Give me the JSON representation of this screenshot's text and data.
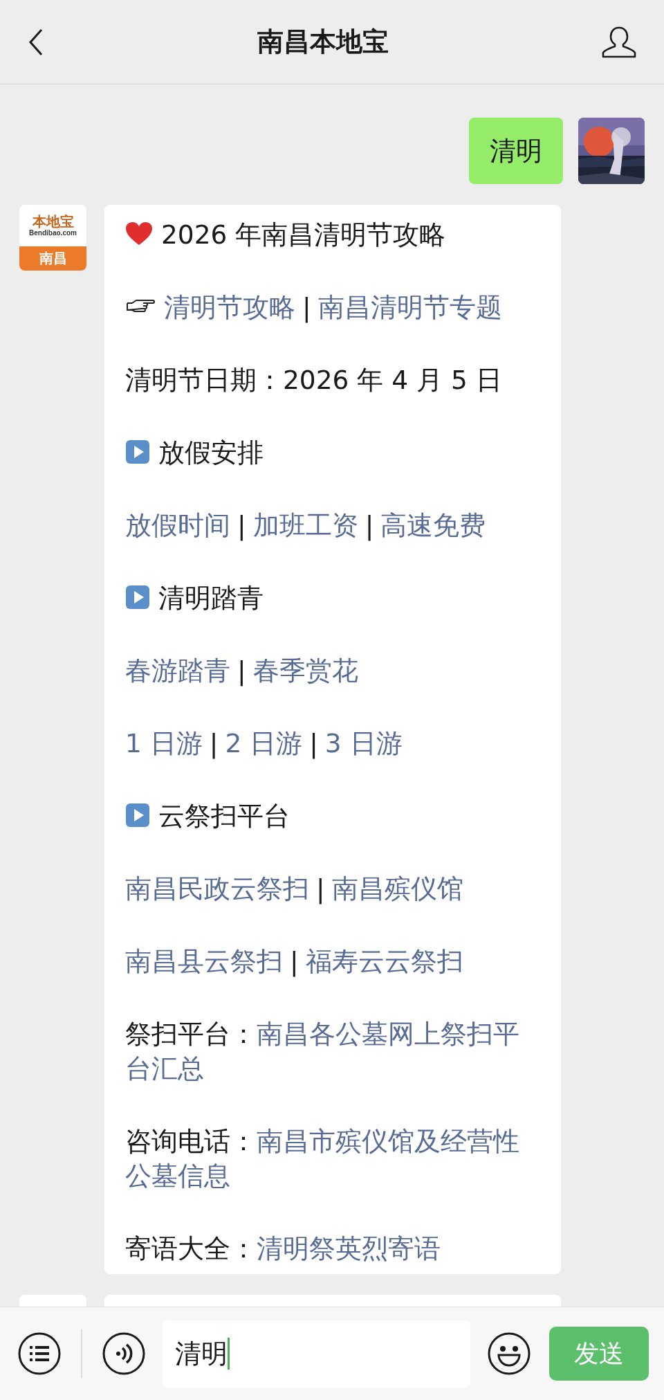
{
  "header": {
    "title": "南昌本地宝"
  },
  "user_message": {
    "text": "清明"
  },
  "bot_avatar": {
    "brand": "本地宝",
    "domain": "Bendibao.com",
    "city": "南昌"
  },
  "message": [
    {
      "kind": "title",
      "parts": [
        {
          "kind": "plain",
          "text": "2026 年南昌清明节攻略"
        }
      ]
    },
    {
      "kind": "pointer",
      "parts": [
        {
          "kind": "link",
          "text": "清明节攻略"
        },
        {
          "kind": "sep",
          "text": "|"
        },
        {
          "kind": "link",
          "text": "南昌清明节专题"
        }
      ]
    },
    {
      "kind": "line",
      "parts": [
        {
          "kind": "plain",
          "text": "清明节日期：2026 年 4 月 5 日"
        }
      ]
    },
    {
      "kind": "heading",
      "parts": [
        {
          "kind": "plain",
          "text": "放假安排"
        }
      ]
    },
    {
      "kind": "line",
      "parts": [
        {
          "kind": "link",
          "text": "放假时间"
        },
        {
          "kind": "sep",
          "text": "|"
        },
        {
          "kind": "link",
          "text": "加班工资"
        },
        {
          "kind": "sep",
          "text": "|"
        },
        {
          "kind": "link",
          "text": "高速免费"
        }
      ]
    },
    {
      "kind": "heading",
      "parts": [
        {
          "kind": "plain",
          "text": "清明踏青"
        }
      ]
    },
    {
      "kind": "line",
      "parts": [
        {
          "kind": "link",
          "text": "春游踏青"
        },
        {
          "kind": "sep",
          "text": "|"
        },
        {
          "kind": "link",
          "text": "春季赏花"
        }
      ]
    },
    {
      "kind": "line",
      "parts": [
        {
          "kind": "link",
          "text": "1 日游"
        },
        {
          "kind": "sep",
          "text": "|"
        },
        {
          "kind": "link",
          "text": "2 日游"
        },
        {
          "kind": "sep",
          "text": "|"
        },
        {
          "kind": "link",
          "text": "3 日游"
        }
      ]
    },
    {
      "kind": "heading",
      "parts": [
        {
          "kind": "plain",
          "text": "云祭扫平台"
        }
      ]
    },
    {
      "kind": "line",
      "parts": [
        {
          "kind": "link",
          "text": "南昌民政云祭扫"
        },
        {
          "kind": "sep",
          "text": "|"
        },
        {
          "kind": "link",
          "text": "南昌殡仪馆"
        }
      ]
    },
    {
      "kind": "line",
      "parts": [
        {
          "kind": "link",
          "text": "南昌县云祭扫"
        },
        {
          "kind": "sep",
          "text": "|"
        },
        {
          "kind": "link",
          "text": "福寿云云祭扫"
        }
      ]
    },
    {
      "kind": "line",
      "parts": [
        {
          "kind": "plain",
          "text": "祭扫平台："
        },
        {
          "kind": "link",
          "text": "南昌各公墓网上祭扫平"
        },
        {
          "kind": "link",
          "text": "台汇总"
        }
      ]
    },
    {
      "kind": "line",
      "parts": [
        {
          "kind": "plain",
          "text": "咨询电话："
        },
        {
          "kind": "link",
          "text": "南昌市殡仪馆及经营性"
        },
        {
          "kind": "link",
          "text": "公墓信息"
        }
      ]
    },
    {
      "kind": "line",
      "parts": [
        {
          "kind": "plain",
          "text": "寄语大全："
        },
        {
          "kind": "link",
          "text": "清明祭英烈寄语"
        }
      ]
    }
  ],
  "input": {
    "value": "清明"
  },
  "send_button": {
    "label": "发送"
  }
}
